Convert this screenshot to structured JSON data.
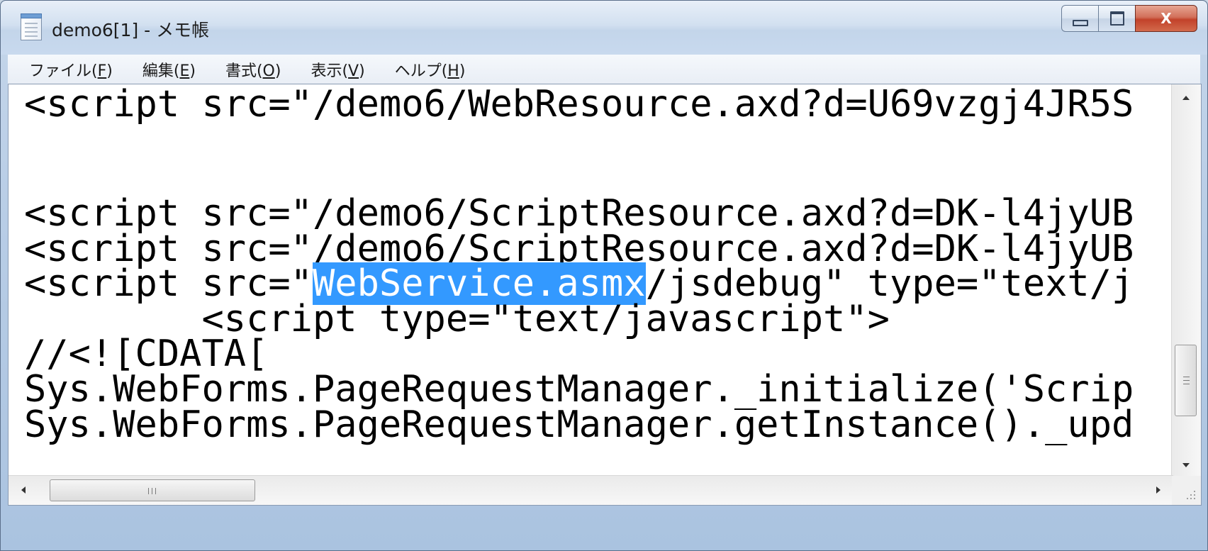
{
  "window": {
    "title": "demo6[1] - メモ帳",
    "app_icon": "notepad-icon",
    "controls": {
      "minimize": "minimize-icon",
      "maximize": "maximize-icon",
      "close": "X"
    }
  },
  "menu": [
    {
      "pre": "ファイル(",
      "acc": "F",
      "post": ")"
    },
    {
      "pre": "編集(",
      "acc": "E",
      "post": ")"
    },
    {
      "pre": "書式(",
      "acc": "O",
      "post": ")"
    },
    {
      "pre": "表示(",
      "acc": "V",
      "post": ")"
    },
    {
      "pre": "ヘルプ(",
      "acc": "H",
      "post": ")"
    }
  ],
  "editor": {
    "lines": [
      {
        "text": "<script src=\"/demo6/WebResource.axd?d=U69vzgj4JR5S"
      },
      {
        "text": ""
      },
      {
        "text": ""
      },
      {
        "text": "<script src=\"/demo6/ScriptResource.axd?d=DK-l4jyUB"
      },
      {
        "text": "<script src=\"/demo6/ScriptResource.axd?d=DK-l4jyUB"
      },
      {
        "before": "<script src=\"",
        "selected": "WebService.asmx",
        "after": "/jsdebug\" type=\"text/j"
      },
      {
        "text": "        <script type=\"text/javascript\">"
      },
      {
        "text": "//<![CDATA["
      },
      {
        "text": "Sys.WebForms.PageRequestManager._initialize('Scrip"
      },
      {
        "text": "Sys.WebForms.PageRequestManager.getInstance()._upd"
      }
    ],
    "selection_text": "WebService.asmx",
    "horizontal_thumb_glyph": "III",
    "vertical_thumb_glyph": "≡"
  },
  "colors": {
    "selection": "#3399ff",
    "close_button": "#c2422a"
  }
}
